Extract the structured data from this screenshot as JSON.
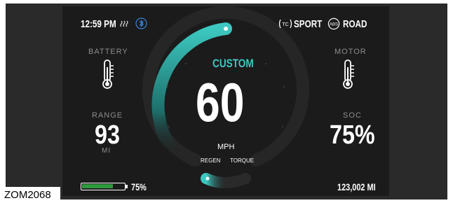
{
  "status_bar": {
    "time": "12:59 PM",
    "icons": [
      "seat-heat-icon",
      "bluetooth-icon"
    ],
    "tc_icon_text": "TC",
    "tc_label": "SPORT",
    "abs_icon_text": "ABS",
    "abs_label": "ROAD"
  },
  "left_panel": {
    "battery_label": "BATTERY",
    "battery_icon": "thermometer-icon",
    "range_label": "RANGE",
    "range_value": "93",
    "range_unit": "MI"
  },
  "right_panel": {
    "motor_label": "MOTOR",
    "motor_icon": "thermometer-icon",
    "soc_label": "SOC",
    "soc_value": "75%"
  },
  "gauge": {
    "mode": "CUSTOM",
    "speed": "60",
    "unit": "MPH",
    "regen_label": "REGEN",
    "torque_label": "TORQUE",
    "speed_fraction": 0.6,
    "accent_color": "#3cc8c0"
  },
  "footer": {
    "battery_percent": "75%",
    "battery_fill_fraction": 0.75,
    "battery_fill_color": "#2e9a3c",
    "odometer": "123,002 MI"
  },
  "caption": {
    "code": "ZOM2068"
  }
}
